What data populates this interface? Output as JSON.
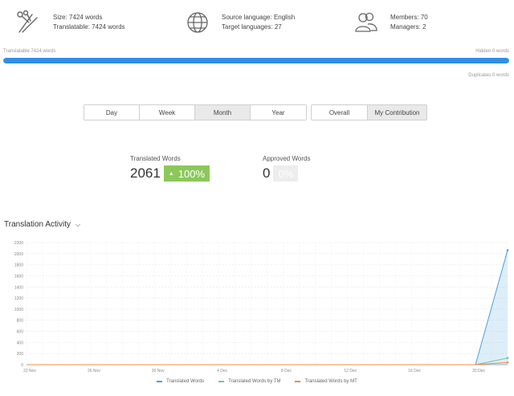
{
  "stats": {
    "size": "Size: 7424 words",
    "translatable": "Translatable: 7424 words",
    "source_language": "Source language: English",
    "target_languages": "Target languages: 27",
    "members": "Members: 70",
    "managers": "Managers: 2"
  },
  "progress": {
    "left_label": "Translatable 7424 words",
    "right_label": "Hidden 0 words",
    "duplicates_label": "Duplicates 0 words",
    "fill_percent": 100
  },
  "period_tabs": [
    {
      "label": "Day",
      "active": false
    },
    {
      "label": "Week",
      "active": false
    },
    {
      "label": "Month",
      "active": true
    },
    {
      "label": "Year",
      "active": false
    }
  ],
  "scope_tabs": [
    {
      "label": "Overall",
      "active": false
    },
    {
      "label": "My Contribution",
      "active": true
    }
  ],
  "metrics": {
    "translated": {
      "label": "Translated Words",
      "value": "2061",
      "change": "100%"
    },
    "approved": {
      "label": "Approved Words",
      "value": "0",
      "change": "0%"
    }
  },
  "section": {
    "title": "Translation Activity"
  },
  "colors": {
    "accent": "#2f8fe6",
    "green": "#8bc85a",
    "series_tw": "#4a9ee0",
    "series_tm": "#6dc7a6",
    "series_mt": "#f08a4b"
  },
  "chart_data": {
    "type": "line",
    "x_ticks": [
      "22 Nov",
      "26 Nov",
      "30 Nov",
      "4 Dec",
      "8 Dec",
      "12 Dec",
      "16 Dec",
      "20 Dec"
    ],
    "y_ticks": [
      0,
      200,
      400,
      600,
      800,
      1000,
      1200,
      1400,
      1600,
      1800,
      2000,
      2200
    ],
    "ylim": [
      0,
      2200
    ],
    "x_day_range": [
      0,
      30
    ],
    "grid": true,
    "legend_position": "bottom",
    "series": [
      {
        "name": "Translated Words",
        "x": [
          0,
          28,
          30
        ],
        "values": [
          0,
          0,
          2061
        ]
      },
      {
        "name": "Translated Words by TM",
        "x": [
          0,
          28,
          30
        ],
        "values": [
          0,
          0,
          120
        ]
      },
      {
        "name": "Translated Words by MT",
        "x": [
          0,
          28,
          30
        ],
        "values": [
          0,
          0,
          40
        ]
      }
    ]
  }
}
